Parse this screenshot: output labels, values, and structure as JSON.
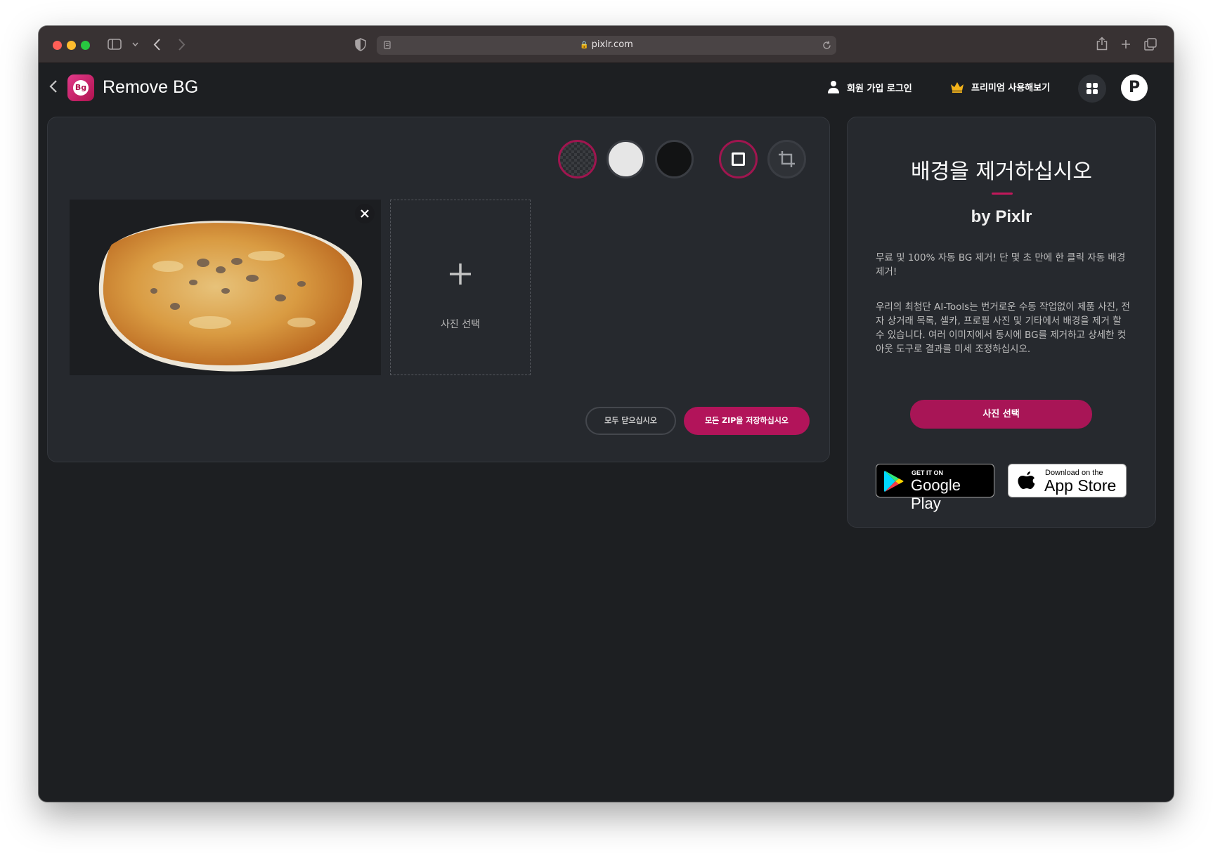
{
  "browser": {
    "url": "pixlr.com"
  },
  "header": {
    "app_title": "Remove BG",
    "logo_text": "Bg",
    "login_label": "회원 가입 로그인",
    "premium_label": "프리미엄 사용해보기",
    "pixlr_logo_text": "P"
  },
  "toolbar": {
    "swatches": [
      "transparent",
      "white",
      "black"
    ],
    "selected_swatch": "transparent",
    "tools": [
      "square-icon",
      "crop-icon"
    ],
    "selected_tool": "square-icon"
  },
  "workspace": {
    "add_photo_label": "사진 선택",
    "close_all_label": "모두 닫으십시오",
    "save_zip_label": "모든 ZIP을 저장하십시오"
  },
  "side": {
    "title": "배경을 제거하십시오",
    "subtitle": "by Pixlr",
    "paragraph1": "무료 및 100% 자동 BG 제거! 단 몇 초 만에 한 클릭 자동 배경 제거!",
    "paragraph2": "우리의 최첨단 AI-Tools는 번거로운 수동 작업없이 제품 사진, 전자 상거래 목록, 셀카, 프로필 사진 및 기타에서 배경을 제거 할 수 있습니다. 여러 이미지에서 동시에 BG를 제거하고 상세한 컷 아웃 도구로 결과를 미세 조정하십시오.",
    "select_photo_label": "사진 선택",
    "google_play_small": "GET IT ON",
    "google_play_big": "Google Play",
    "app_store_small": "Download on the",
    "app_store_big": "App Store"
  },
  "colors": {
    "accent": "#b2145a",
    "panel": "#26292e",
    "background": "#1d1f22"
  }
}
